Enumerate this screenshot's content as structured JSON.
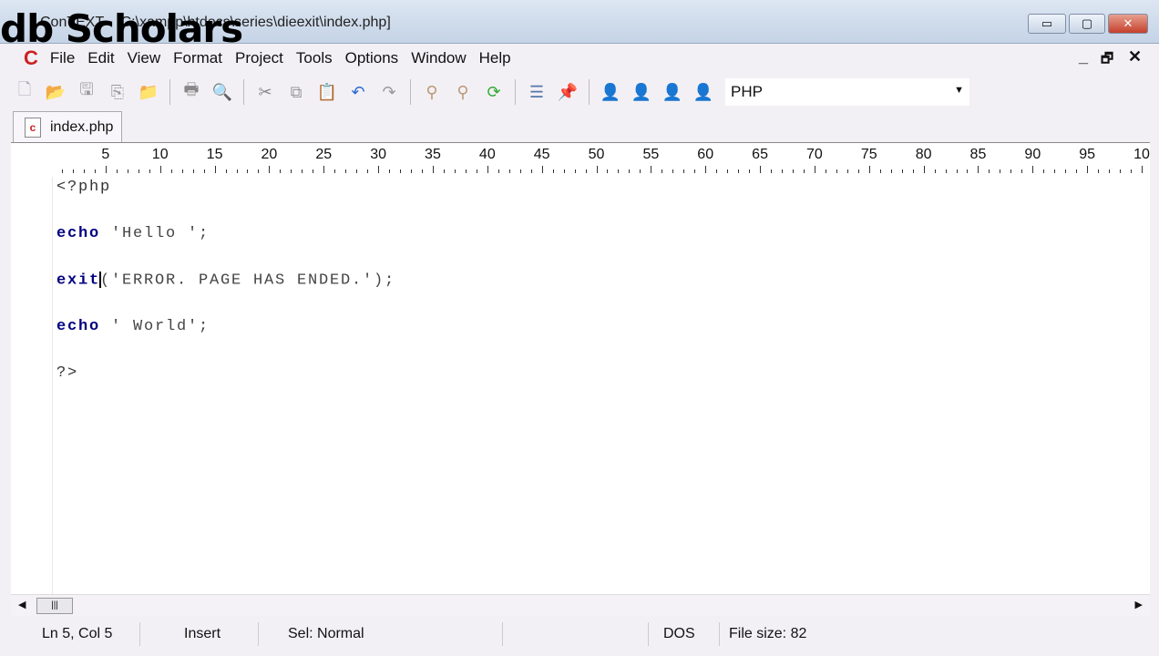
{
  "window": {
    "title": "ConTEXT - [C:\\xampp\\htdocs\\series\\dieexit\\index.php]",
    "watermark": "db Scholars",
    "minimize": "▭",
    "maximize": "▢",
    "close": "✕"
  },
  "menu": [
    "File",
    "Edit",
    "View",
    "Format",
    "Project",
    "Tools",
    "Options",
    "Window",
    "Help"
  ],
  "mdi": {
    "minimize": "_",
    "restore": "🗗",
    "close": "✕"
  },
  "toolbar": {
    "icons": [
      "new-file",
      "open",
      "save",
      "save-all",
      "open-folder",
      "print",
      "print-preview",
      "cut",
      "copy",
      "paste",
      "undo",
      "redo",
      "find",
      "find-next",
      "replace",
      "format",
      "pin",
      "user-1",
      "user-2",
      "user-3",
      "user-4"
    ],
    "language": "PHP"
  },
  "tab": {
    "label": "index.php"
  },
  "ruler": [
    "5",
    "10",
    "15",
    "20",
    "25",
    "30",
    "35",
    "40",
    "45",
    "50",
    "55",
    "60",
    "65",
    "70",
    "75",
    "80",
    "85",
    "90",
    "95",
    "10"
  ],
  "code": {
    "l1": "<?php",
    "l3_kw": "echo",
    "l3_rest": " 'Hello ';",
    "l5_kw": "exit",
    "l5_rest": "('ERROR. PAGE HAS ENDED.');",
    "l7_kw": "echo",
    "l7_rest": " ' World';",
    "l9": "?>"
  },
  "status": {
    "position": "Ln 5, Col 5",
    "mode": "Insert",
    "sel": "Sel: Normal",
    "blank": "",
    "format": "DOS",
    "size": "File size: 82"
  }
}
